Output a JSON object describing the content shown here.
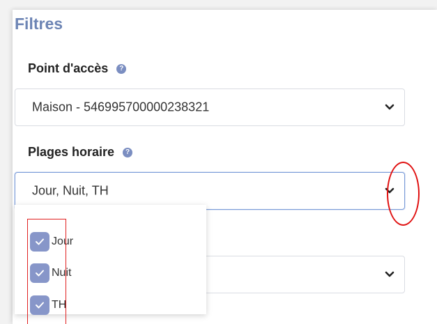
{
  "filters": {
    "title": "Filtres",
    "access_point": {
      "label": "Point d'accès",
      "value": "Maison - 546995700000238321"
    },
    "time_slots": {
      "label": "Plages horaire",
      "value": "Jour, Nuit, TH",
      "options": [
        {
          "label": "Jour",
          "checked": true
        },
        {
          "label": "Nuit",
          "checked": true
        },
        {
          "label": "TH",
          "checked": true
        }
      ]
    },
    "third_select": {
      "value": ""
    }
  },
  "colors": {
    "accent": "#6c84b4",
    "checkbox": "#8796c9",
    "annotation": "#e02020"
  },
  "icons": [
    "help-icon",
    "chevron-down-icon",
    "check-icon"
  ]
}
